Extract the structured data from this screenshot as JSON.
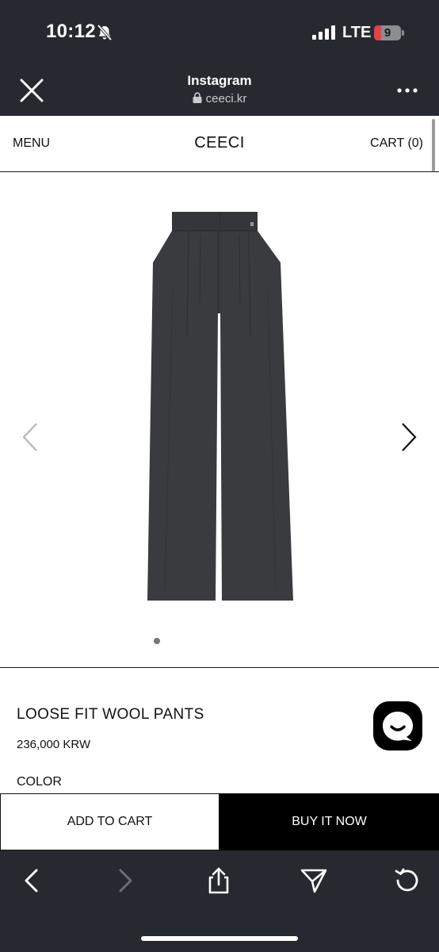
{
  "status_bar": {
    "time": "10:12",
    "network": "LTE",
    "battery": "9",
    "icons": [
      "bell-slash-icon",
      "signal-icon",
      "battery-icon"
    ]
  },
  "browser": {
    "title": "Instagram",
    "url": "ceeci.kr",
    "icons": [
      "close-icon",
      "lock-icon",
      "more-icon"
    ]
  },
  "header": {
    "menu_label": "MENU",
    "brand": "CEECI",
    "cart_label": "CART (0)"
  },
  "gallery": {
    "image": "product-pants-image",
    "icons": [
      "chevron-left-icon",
      "chevron-right-icon"
    ],
    "total_slides": 1,
    "active_slide": 1
  },
  "product": {
    "name": "LOOSE FIT WOOL PANTS",
    "price": "236,000 KRW",
    "color_label": "COLOR"
  },
  "chat": {
    "icon": "chat-icon"
  },
  "actions": {
    "add_to_cart": "ADD TO CART",
    "buy_now": "BUY IT NOW"
  },
  "bottom_nav": {
    "icons": [
      "back-icon",
      "forward-icon",
      "share-icon",
      "send-icon",
      "reload-icon"
    ]
  },
  "colors": {
    "chrome": "#262930",
    "pants": "#3a3b3f",
    "battery_low": "#e0434a"
  }
}
